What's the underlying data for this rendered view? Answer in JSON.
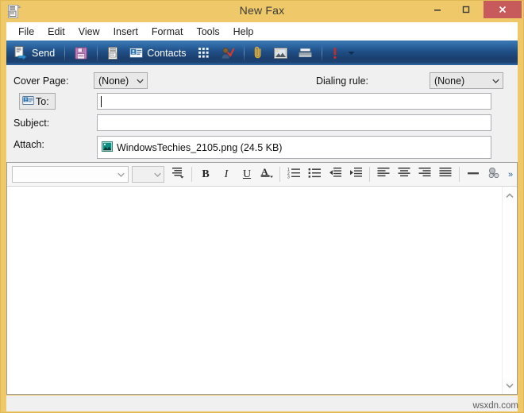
{
  "window": {
    "title": "New Fax",
    "icon": "fax-document-icon",
    "frame_color": "#EFC969",
    "caption_buttons": [
      {
        "name": "minimize",
        "glyph": "–"
      },
      {
        "name": "maximize",
        "glyph": "□"
      },
      {
        "name": "close",
        "glyph": "✕",
        "color": "#C75B5B"
      }
    ]
  },
  "menubar": {
    "items": [
      {
        "label": "File"
      },
      {
        "label": "Edit"
      },
      {
        "label": "View"
      },
      {
        "label": "Insert"
      },
      {
        "label": "Format"
      },
      {
        "label": "Tools"
      },
      {
        "label": "Help"
      }
    ]
  },
  "toolbar": {
    "background": "#1f4e86",
    "items": [
      {
        "type": "button",
        "icon": "send-fax-icon",
        "label": "Send"
      },
      {
        "type": "separator"
      },
      {
        "type": "button",
        "icon": "save-floppy-icon",
        "label": ""
      },
      {
        "type": "separator"
      },
      {
        "type": "button",
        "icon": "cover-page-icon",
        "label": ""
      },
      {
        "type": "button",
        "icon": "contacts-card-icon",
        "label": "Contacts"
      },
      {
        "type": "button",
        "icon": "dial-pad-icon",
        "label": ""
      },
      {
        "type": "button",
        "icon": "check-names-icon",
        "label": ""
      },
      {
        "type": "separator"
      },
      {
        "type": "button",
        "icon": "attach-paperclip-icon",
        "label": ""
      },
      {
        "type": "button",
        "icon": "insert-picture-icon",
        "label": ""
      },
      {
        "type": "button",
        "icon": "scanner-icon",
        "label": ""
      },
      {
        "type": "separator"
      },
      {
        "type": "button",
        "icon": "high-priority-icon",
        "label": ""
      },
      {
        "type": "button",
        "icon": "chevron-down-icon",
        "label": ""
      }
    ]
  },
  "fields": {
    "cover_page_label": "Cover Page:",
    "cover_page_value": "(None)",
    "dialing_rule_label": "Dialing rule:",
    "dialing_rule_value": "(None)",
    "to_button_label": "To:",
    "to_value": "",
    "subject_label": "Subject:",
    "subject_value": "",
    "attach_label": "Attach:",
    "attachment": {
      "icon": "image-file-icon",
      "name": "WindowsTechies_2105.png (24.5 KB)"
    }
  },
  "format_toolbar": {
    "font_name": "",
    "font_size": "",
    "buttons": [
      {
        "name": "paragraph-style-icon",
        "glyph": "≡"
      },
      {
        "name": "bold-button",
        "glyph": "B"
      },
      {
        "name": "italic-button",
        "glyph": "I"
      },
      {
        "name": "underline-button",
        "glyph": "U"
      },
      {
        "name": "font-color-button",
        "glyph": "A"
      },
      {
        "name": "numbered-list-button",
        "glyph": "1."
      },
      {
        "name": "bulleted-list-button",
        "glyph": "•"
      },
      {
        "name": "decrease-indent-button",
        "glyph": "←"
      },
      {
        "name": "increase-indent-button",
        "glyph": "→"
      },
      {
        "name": "align-left-button",
        "glyph": "≡"
      },
      {
        "name": "align-center-button",
        "glyph": "≡"
      },
      {
        "name": "align-right-button",
        "glyph": "≡"
      },
      {
        "name": "justify-button",
        "glyph": "≡"
      },
      {
        "name": "horizontal-rule-button",
        "glyph": "—"
      },
      {
        "name": "insert-link-button",
        "glyph": "⚭"
      },
      {
        "name": "overflow-button",
        "glyph": "»"
      }
    ]
  },
  "body": {
    "text": ""
  },
  "scrollbar": {
    "up_glyph": "∧",
    "down_glyph": "∨"
  },
  "watermark": "wsxdn.com"
}
